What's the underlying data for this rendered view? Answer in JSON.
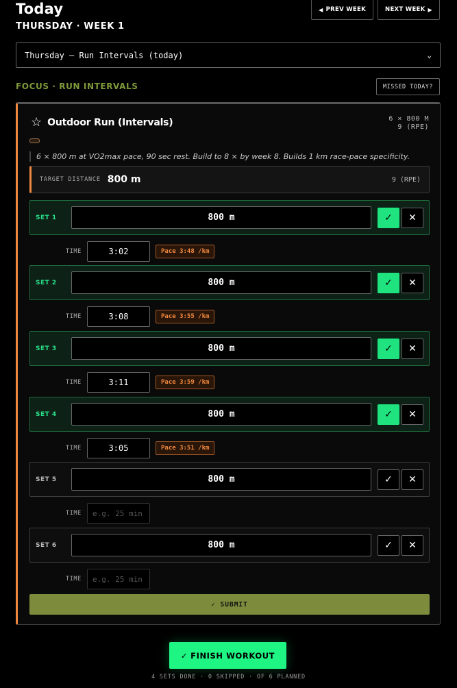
{
  "header": {
    "title": "Today",
    "subtitle": "THURSDAY · WEEK 1"
  },
  "week_nav": {
    "prev_label": "PREV WEEK",
    "next_label": "NEXT WEEK"
  },
  "day_select": {
    "value": "Thursday — Run Intervals (today)"
  },
  "focus": {
    "label": "FOCUS · RUN INTERVALS",
    "missed_label": "MISSED TODAY?"
  },
  "exercise": {
    "name": "Outdoor Run (Intervals)",
    "meta_line1": "6 × 800 M",
    "meta_line2": "9 (RPE)",
    "description": "6 × 800 m at VO2max pace, 90 sec rest. Build to 8 × by week 8. Builds 1 km race-pace specificity.",
    "target_label": "TARGET DISTANCE",
    "target_value": "800 m",
    "target_rpe": "9 (RPE)",
    "time_label": "TIME",
    "time_placeholder": "e.g. 25 min",
    "sets": [
      {
        "label": "SET 1",
        "value": "800 m",
        "done": true,
        "time": "3:02",
        "pace": "Pace 3:48 /km"
      },
      {
        "label": "SET 2",
        "value": "800 m",
        "done": true,
        "time": "3:08",
        "pace": "Pace 3:55 /km"
      },
      {
        "label": "SET 3",
        "value": "800 m",
        "done": true,
        "time": "3:11",
        "pace": "Pace 3:59 /km"
      },
      {
        "label": "SET 4",
        "value": "800 m",
        "done": true,
        "time": "3:05",
        "pace": "Pace 3:51 /km"
      },
      {
        "label": "SET 5",
        "value": "800 m",
        "done": false,
        "time": "",
        "pace": ""
      },
      {
        "label": "SET 6",
        "value": "800 m",
        "done": false,
        "time": "",
        "pace": ""
      }
    ],
    "submit_label": "✓ SUBMIT"
  },
  "finish": {
    "label": "FINISH WORKOUT",
    "summary": "4 SETS DONE · 0 SKIPPED · OF 6 PLANNED"
  },
  "colors": {
    "accent_orange": "#f0883e",
    "accent_green": "#1ef582",
    "focus_olive": "#7f9a3a"
  }
}
